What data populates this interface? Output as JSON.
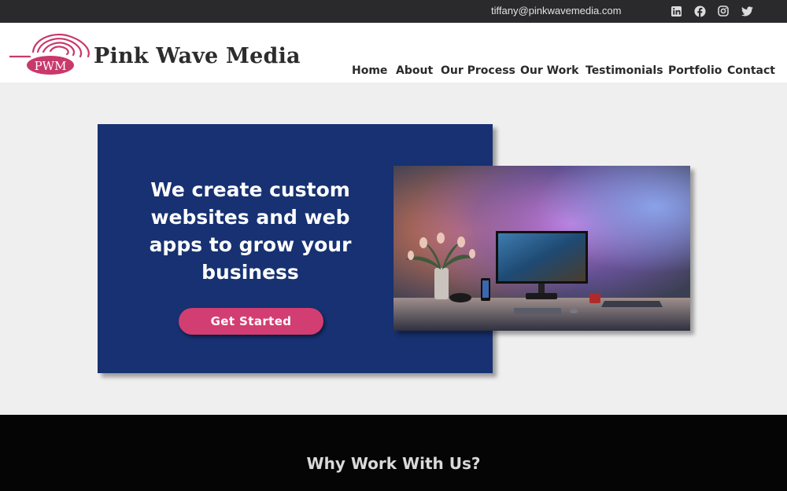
{
  "topbar": {
    "email": "tiffany@pinkwavemedia.com",
    "social_icons": [
      "linkedin-icon",
      "facebook-icon",
      "instagram-icon",
      "twitter-icon"
    ]
  },
  "header": {
    "logo_text": "PWM",
    "brand_name": "Pink Wave Media",
    "nav": [
      "Home",
      "About",
      "Our Process",
      "Our Work",
      "Testimonials",
      "Portfolio",
      "Contact"
    ]
  },
  "hero": {
    "title": "We create custom websites and web apps to grow your business",
    "cta_label": "Get Started",
    "photo_icon": "desk-setup-photo"
  },
  "section": {
    "title": "Why Work With Us?"
  },
  "colors": {
    "topbar": "#2a2a2c",
    "hero_blue": "#173172",
    "accent_pink": "#d23e72",
    "dark_section": "#050505"
  }
}
